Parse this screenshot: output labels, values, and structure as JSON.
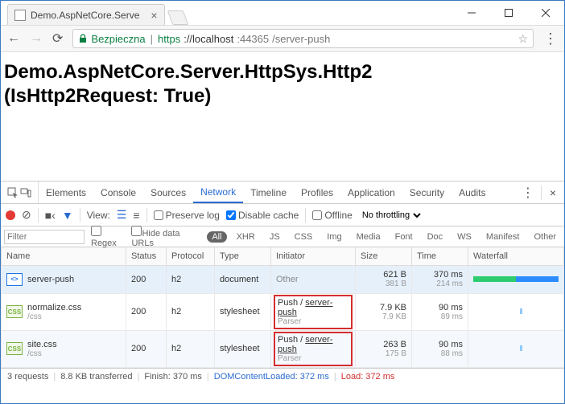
{
  "window": {
    "tab_title": "Demo.AspNetCore.Serve"
  },
  "address": {
    "secure_label": "Bezpieczna",
    "scheme": "https",
    "host": "://localhost",
    "port": ":44365",
    "path": "/server-push"
  },
  "page": {
    "heading_l1": "Demo.AspNetCore.Server.HttpSys.Http2",
    "heading_l2": "(IsHttp2Request: True)"
  },
  "devtools": {
    "tabs": [
      "Elements",
      "Console",
      "Sources",
      "Network",
      "Timeline",
      "Profiles",
      "Application",
      "Security",
      "Audits"
    ],
    "active_tab": "Network",
    "toolbar": {
      "view_label": "View:",
      "preserve_log": "Preserve log",
      "disable_cache": "Disable cache",
      "offline": "Offline",
      "throttle": "No throttling",
      "preserve_checked": false,
      "cache_checked": true,
      "offline_checked": false
    },
    "filter": {
      "placeholder": "Filter",
      "regex": "Regex",
      "hide_data": "Hide data URLs",
      "types": [
        "All",
        "XHR",
        "JS",
        "CSS",
        "Img",
        "Media",
        "Font",
        "Doc",
        "WS",
        "Manifest",
        "Other"
      ]
    },
    "columns": [
      "Name",
      "Status",
      "Protocol",
      "Type",
      "Initiator",
      "Size",
      "Time",
      "Waterfall"
    ],
    "rows": [
      {
        "name": "server-push",
        "sub": "",
        "icon": "doc",
        "status": "200",
        "protocol": "h2",
        "type": "document",
        "initiator": "Other",
        "initiator_sub": "",
        "size": "621 B",
        "size_sub": "381 B",
        "time": "370 ms",
        "time_sub": "214 ms",
        "boxed": false,
        "bars": [
          {
            "l": 0,
            "w": 50,
            "c": "#2ecc71"
          },
          {
            "l": 50,
            "w": 50,
            "c": "#2b8cff"
          }
        ]
      },
      {
        "name": "normalize.css",
        "sub": "/css",
        "icon": "css",
        "status": "200",
        "protocol": "h2",
        "type": "stylesheet",
        "initiator": "Push / ",
        "initiator_link": "server-push",
        "initiator_sub": "Parser",
        "size": "7.9 KB",
        "size_sub": "7.9 KB",
        "time": "90 ms",
        "time_sub": "89 ms",
        "boxed": true,
        "bars": [
          {
            "l": 55,
            "w": 3,
            "c": "#90caf9"
          }
        ]
      },
      {
        "name": "site.css",
        "sub": "/css",
        "icon": "css",
        "status": "200",
        "protocol": "h2",
        "type": "stylesheet",
        "initiator": "Push / ",
        "initiator_link": "server-push",
        "initiator_sub": "Parser",
        "size": "263 B",
        "size_sub": "175 B",
        "time": "90 ms",
        "time_sub": "88 ms",
        "boxed": true,
        "bars": [
          {
            "l": 55,
            "w": 3,
            "c": "#90caf9"
          }
        ]
      }
    ],
    "status": {
      "requests": "3 requests",
      "transferred": "8.8 KB transferred",
      "finish": "Finish: 370 ms",
      "dcl": "DOMContentLoaded: 372 ms",
      "load": "Load: 372 ms"
    }
  }
}
